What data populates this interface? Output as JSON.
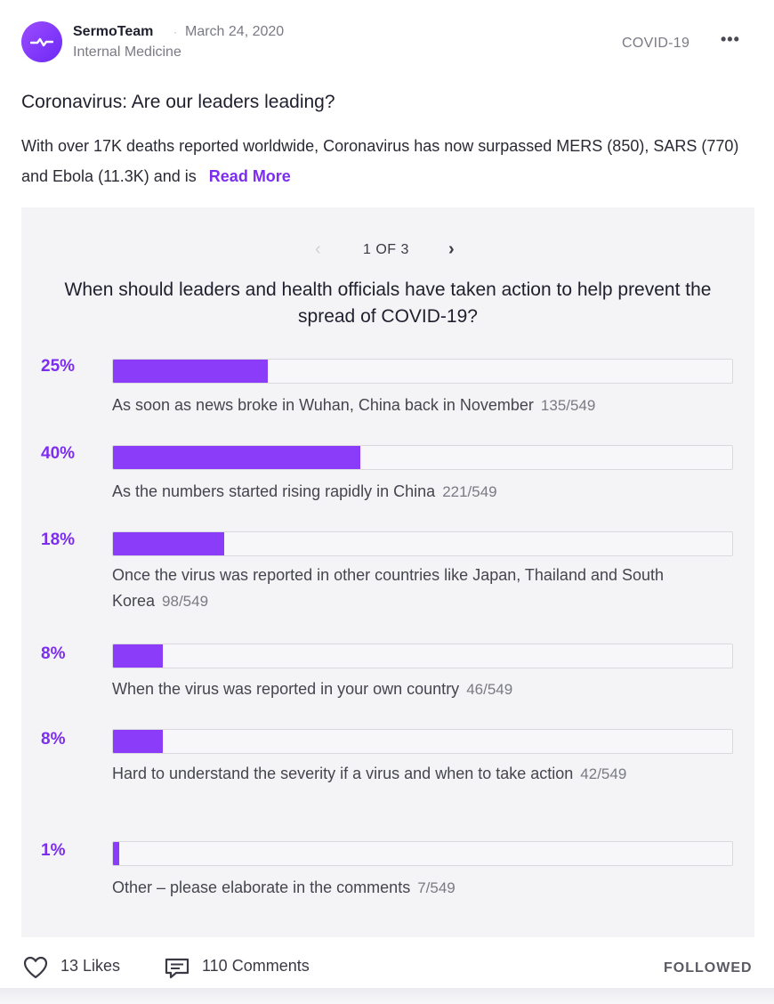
{
  "post": {
    "author": "SermoTeam",
    "separator": "·",
    "date": "March 24, 2020",
    "specialty": "Internal Medicine",
    "tag": "COVID-19",
    "more_icon": "•••",
    "title": "Coronavirus: Are our leaders leading?",
    "excerpt": "With over 17K deaths reported worldwide, Coronavirus has now surpassed MERS (850), SARS (770) and Ebola (11.3K) and is",
    "read_more": "Read More"
  },
  "poll": {
    "prev_icon": "‹",
    "page": "1 OF 3",
    "next_icon": "›",
    "question": "When should leaders and health officials have taken action to help prevent the spread of COVID-19?",
    "options": [
      {
        "percent": "25%",
        "fraction": 0.25,
        "label": "As soon as news broke in Wuhan, China back in November",
        "count": "135/549"
      },
      {
        "percent": "40%",
        "fraction": 0.4,
        "label": "As the numbers started rising rapidly in China",
        "count": "221/549"
      },
      {
        "percent": "18%",
        "fraction": 0.18,
        "label": "Once the virus was reported in other countries like Japan, Thailand and South Korea",
        "count": "98/549"
      },
      {
        "percent": "8%",
        "fraction": 0.08,
        "label": "When the virus was reported in your own country",
        "count": "46/549"
      },
      {
        "percent": "8%",
        "fraction": 0.08,
        "label": "Hard to understand the severity if a virus and when to take action",
        "count": "42/549"
      },
      {
        "percent": "1%",
        "fraction": 0.01,
        "label": "Other – please elaborate in the comments",
        "count": "7/549"
      }
    ]
  },
  "footer": {
    "likes": "13 Likes",
    "comments": "110 Comments",
    "followed": "FOLLOWED"
  },
  "colors": {
    "accent": "#7c2df0",
    "bar": "#8a3cf8",
    "panel": "#f4f4f6"
  },
  "icons": {
    "avatar": "pulse-icon",
    "like": "heart-icon",
    "comment": "comment-icon",
    "more": "more-icon"
  }
}
